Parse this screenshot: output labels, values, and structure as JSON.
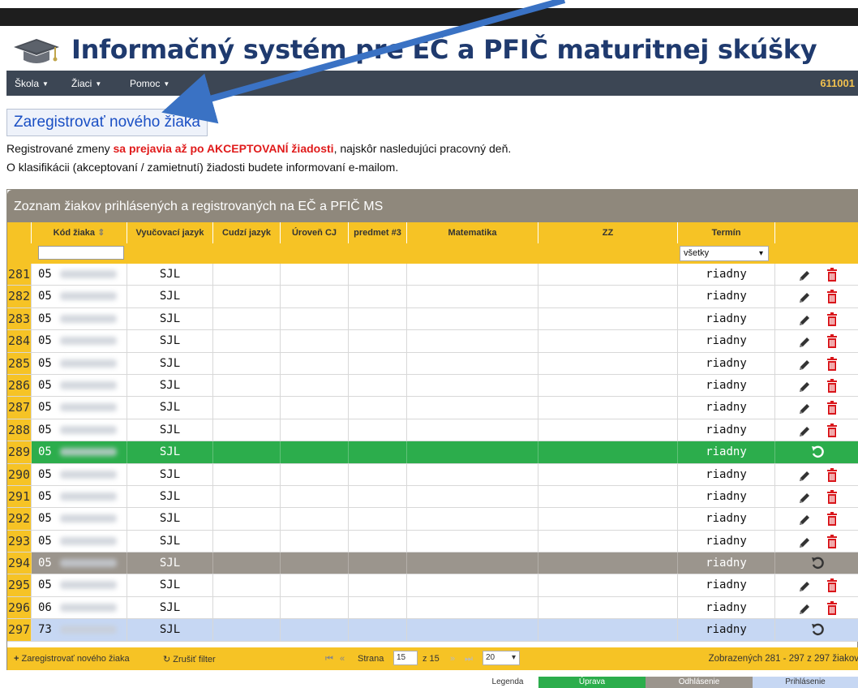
{
  "header": {
    "title": "Informačný systém pre EČ a PFIČ maturitnej skúšky",
    "logo_icon": "graduation-cap-icon"
  },
  "nav": {
    "items": [
      {
        "label": "Škola"
      },
      {
        "label": "Žiaci"
      },
      {
        "label": "Pomoc"
      }
    ],
    "school_code": "611001"
  },
  "register_button_label": "Zaregistrovať nového žiaka",
  "info": {
    "line1_prefix": "Registrované zmeny ",
    "line1_emphasis": "sa prejavia až po AKCEPTOVANÍ žiadosti",
    "line1_suffix": ", najskôr nasledujúci pracovný deň.",
    "line2": "O klasifikácii (akceptovaní / zamietnutí) žiadosti budete informovaní e-mailom."
  },
  "table": {
    "title": "Zoznam žiakov prihlásených a registrovaných na EČ a PFIČ MS",
    "columns": [
      "Kód žiaka",
      "Vyučovací jazyk",
      "Cudzí jazyk",
      "Úroveň CJ",
      "predmet #3",
      "Matematika",
      "ZZ",
      "Termín"
    ],
    "sort_icon": "sort-icon",
    "filter_select_value": "všetky",
    "rows": [
      {
        "num": "281",
        "code": "05",
        "lang": "SJL",
        "term": "riadny",
        "state": "normal"
      },
      {
        "num": "282",
        "code": "05",
        "lang": "SJL",
        "term": "riadny",
        "state": "normal"
      },
      {
        "num": "283",
        "code": "05",
        "lang": "SJL",
        "term": "riadny",
        "state": "normal"
      },
      {
        "num": "284",
        "code": "05",
        "lang": "SJL",
        "term": "riadny",
        "state": "normal"
      },
      {
        "num": "285",
        "code": "05",
        "lang": "SJL",
        "term": "riadny",
        "state": "normal"
      },
      {
        "num": "286",
        "code": "05",
        "lang": "SJL",
        "term": "riadny",
        "state": "normal"
      },
      {
        "num": "287",
        "code": "05",
        "lang": "SJL",
        "term": "riadny",
        "state": "normal"
      },
      {
        "num": "288",
        "code": "05",
        "lang": "SJL",
        "term": "riadny",
        "state": "normal"
      },
      {
        "num": "289",
        "code": "05",
        "lang": "SJL",
        "term": "riadny",
        "state": "green"
      },
      {
        "num": "290",
        "code": "05",
        "lang": "SJL",
        "term": "riadny",
        "state": "normal"
      },
      {
        "num": "291",
        "code": "05",
        "lang": "SJL",
        "term": "riadny",
        "state": "normal"
      },
      {
        "num": "292",
        "code": "05",
        "lang": "SJL",
        "term": "riadny",
        "state": "normal"
      },
      {
        "num": "293",
        "code": "05",
        "lang": "SJL",
        "term": "riadny",
        "state": "normal"
      },
      {
        "num": "294",
        "code": "05",
        "lang": "SJL",
        "term": "riadny",
        "state": "gray"
      },
      {
        "num": "295",
        "code": "05",
        "lang": "SJL",
        "term": "riadny",
        "state": "normal"
      },
      {
        "num": "296",
        "code": "06",
        "lang": "SJL",
        "term": "riadny",
        "state": "normal"
      },
      {
        "num": "297",
        "code": "73",
        "lang": "SJL",
        "term": "riadny",
        "state": "blue"
      }
    ]
  },
  "pager": {
    "add_label": "Zaregistrovať nového žiaka",
    "clear_filter_label": "Zrušiť filter",
    "page_label": "Strana",
    "page_value": "15",
    "of_label": "z 15",
    "page_size": "20",
    "summary": "Zobrazených 281 - 297 z 297 žiakov"
  },
  "legend": {
    "label": "Legenda",
    "items": [
      {
        "label": "Úprava",
        "color": "#2cad4c"
      },
      {
        "label": "Odhlásenie",
        "color": "#9b958d"
      },
      {
        "label": "Prihlásenie",
        "color": "#c6d7f3"
      }
    ]
  },
  "colors": {
    "accent_yellow": "#f6c325",
    "title_blue": "#1f3a6e",
    "warning_red": "#e01b1b",
    "delete_red": "#d9161b"
  }
}
